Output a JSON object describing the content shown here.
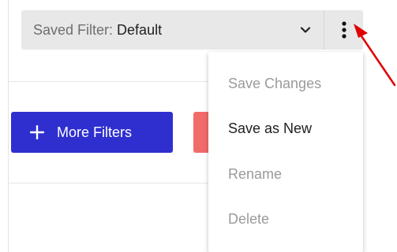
{
  "saved_filter": {
    "label": "Saved Filter:",
    "value": "Default",
    "chevron_icon": "chevron-down-icon",
    "menu_icon": "vertical-ellipsis-icon"
  },
  "toolbar": {
    "more_filters_label": "More Filters",
    "more_filters_icon": "plus-icon",
    "accent_color": "#2f2fd0",
    "danger_color": "#f26b6b"
  },
  "menu": {
    "items": [
      {
        "label": "Save Changes",
        "disabled": true
      },
      {
        "label": "Save as New",
        "disabled": false
      },
      {
        "label": "Rename",
        "disabled": true
      },
      {
        "label": "Delete",
        "disabled": true
      }
    ]
  },
  "annotation": {
    "color": "#e00000"
  }
}
